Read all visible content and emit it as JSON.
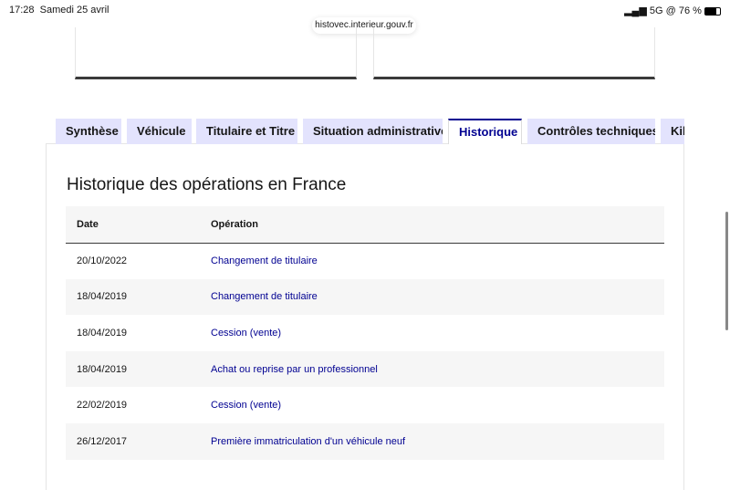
{
  "status_bar": {
    "time": "17:28",
    "date": "Samedi 25 avril",
    "signal": "5G",
    "battery": "76 %"
  },
  "browser": {
    "url": "histovec.interieur.gouv.fr"
  },
  "tabs": [
    "Synthèse",
    "Véhicule",
    "Titulaire et Titre",
    "Situation administrative",
    "Historique",
    "Contrôles techniques",
    "Kilométrage"
  ],
  "active_tab": "Historique",
  "section": {
    "title": "Historique des opérations en France",
    "columns": [
      "Date",
      "Opération"
    ],
    "rows": [
      {
        "date": "20/10/2022",
        "operation": "Changement de titulaire"
      },
      {
        "date": "18/04/2019",
        "operation": "Changement de titulaire"
      },
      {
        "date": "18/04/2019",
        "operation": "Cession (vente)"
      },
      {
        "date": "18/04/2019",
        "operation": "Achat ou reprise par un professionnel"
      },
      {
        "date": "22/02/2019",
        "operation": "Cession (vente)"
      },
      {
        "date": "26/12/2017",
        "operation": "Première immatriculation d'un véhicule neuf"
      }
    ]
  },
  "colors": {
    "accent": "#000091",
    "tab_bg": "#e3e3fd"
  }
}
